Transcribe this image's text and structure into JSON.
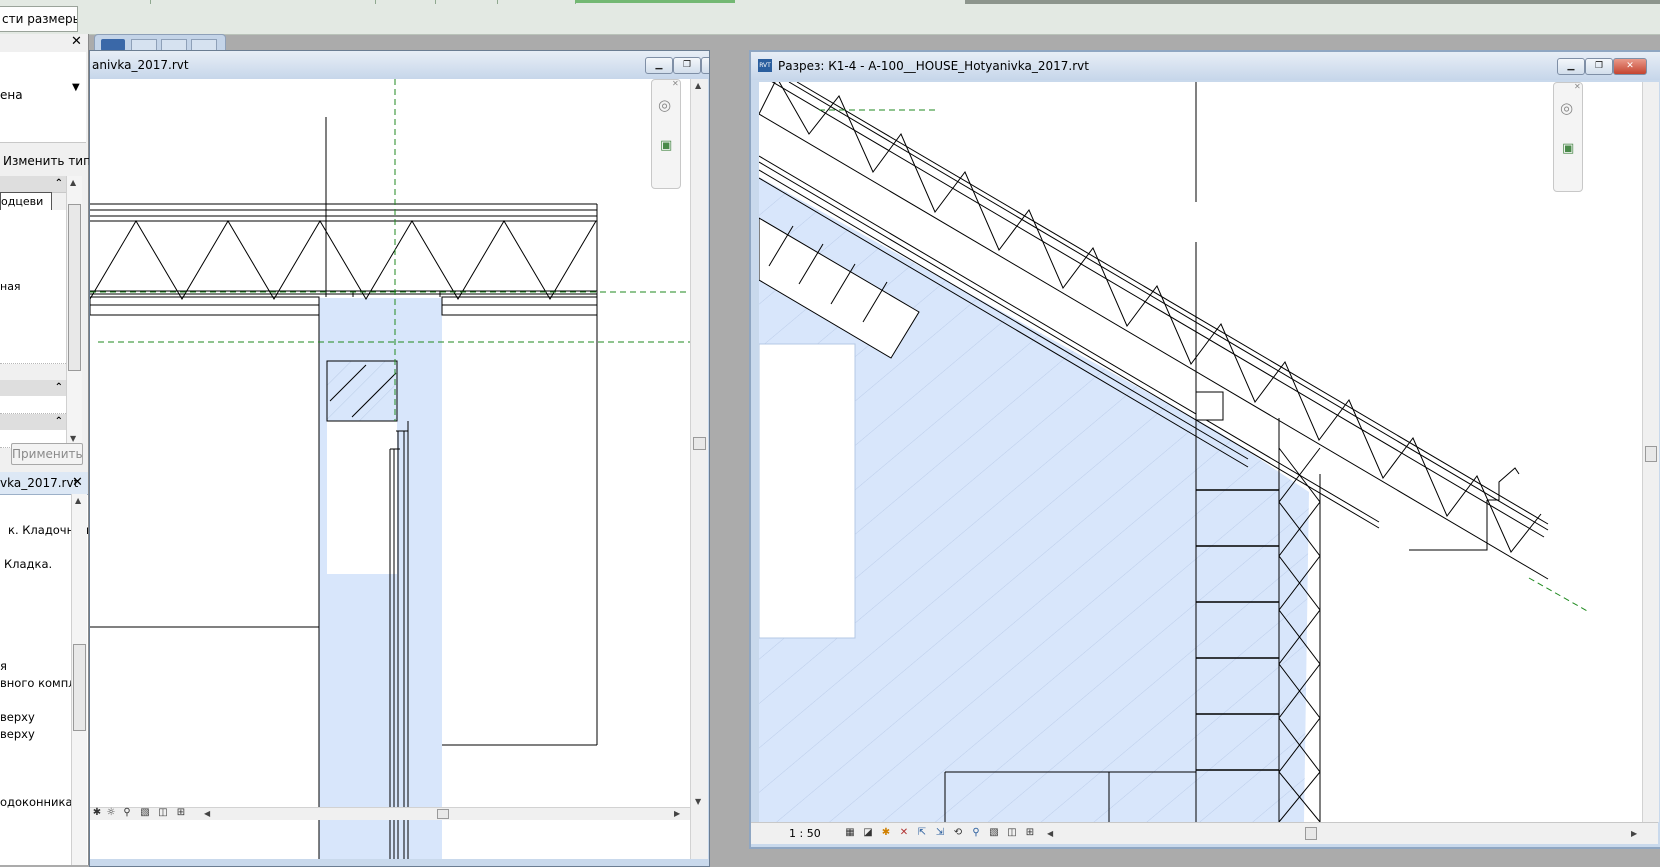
{
  "topbar": {
    "dimensions_tab_label": "сти размеры"
  },
  "properties": {
    "type_value": "ена",
    "edit_type_label": "Изменить тип",
    "rows": [
      "одцеви",
      "",
      "",
      "",
      "",
      "ная",
      "",
      "",
      "",
      ""
    ],
    "apply_label": "Применить"
  },
  "project_browser": {
    "title": "vka_2017.rvt",
    "items": [
      "к. Кладочний",
      "Кладка.",
      "я",
      "вного компл",
      "верху",
      "верху",
      "одоконника"
    ]
  },
  "left_view": {
    "title": "anivka_2017.rvt"
  },
  "right_view": {
    "title": "Разрез: К1-4 - А-100__HOUSE_Hotyanivka_2017.rvt",
    "file_badge": "RVT",
    "scale": "1 : 50"
  },
  "icons": {
    "nav_wheel": "steering-wheel-icon",
    "zoom": "zoom-region-icon",
    "close": "close-icon",
    "minimize": "minimize-icon",
    "restore": "restore-icon"
  },
  "colors": {
    "cut_fill": "#d8e6fb",
    "reference_line": "#1f8a1f",
    "title_bar": "#c6d6ea"
  }
}
